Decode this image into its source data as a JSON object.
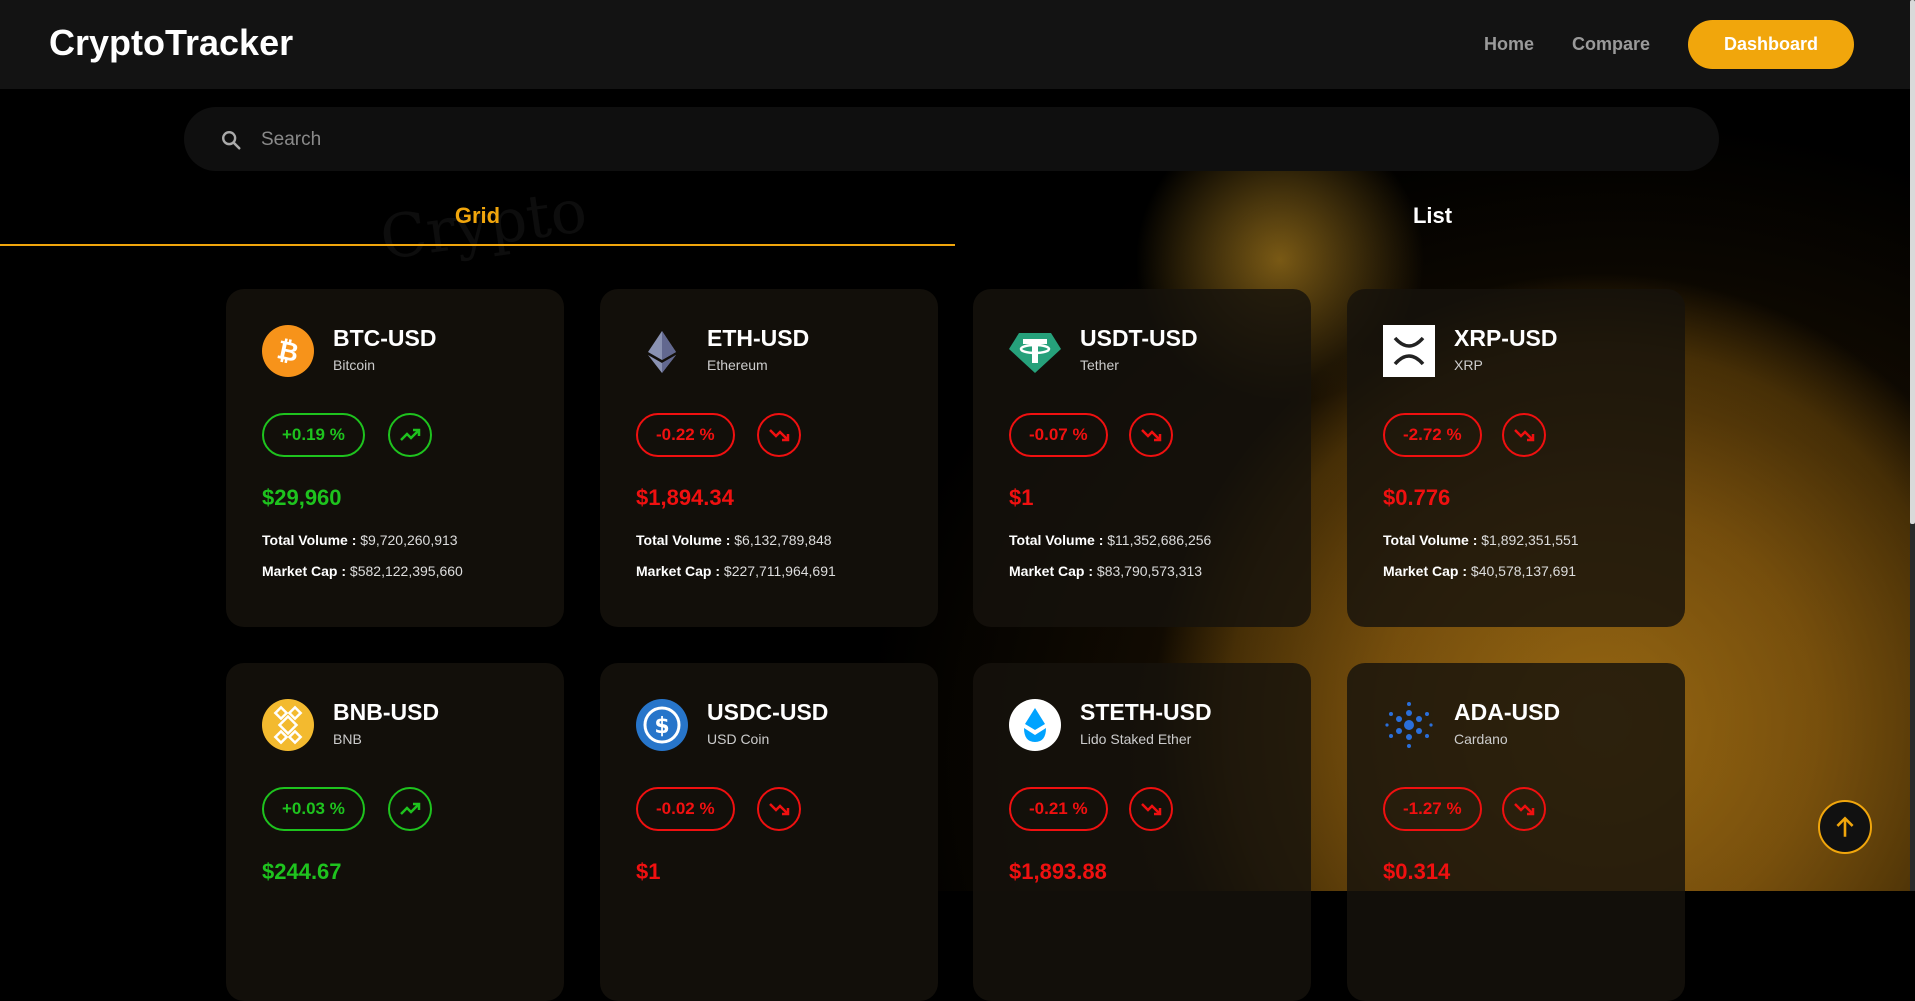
{
  "header": {
    "logo": "CryptoTracker",
    "nav": {
      "home": "Home",
      "compare": "Compare",
      "dashboard": "Dashboard"
    }
  },
  "search": {
    "placeholder": "Search",
    "value": ""
  },
  "tabs": {
    "grid": "Grid",
    "list": "List",
    "active": "Grid"
  },
  "colors": {
    "accent": "#f1a60c",
    "up": "#1ec31e",
    "down": "#f01010"
  },
  "cards": [
    {
      "symbol": "BTC-USD",
      "name": "Bitcoin",
      "change": "+0.19 %",
      "trend": "up",
      "price": "$29,960",
      "volume_label": "Total Volume :",
      "volume": "$9,720,260,913",
      "cap_label": "Market Cap :",
      "cap": "$582,122,395,660",
      "icon": "bitcoin-icon"
    },
    {
      "symbol": "ETH-USD",
      "name": "Ethereum",
      "change": "-0.22 %",
      "trend": "down",
      "price": "$1,894.34",
      "volume_label": "Total Volume :",
      "volume": "$6,132,789,848",
      "cap_label": "Market Cap :",
      "cap": "$227,711,964,691",
      "icon": "ethereum-icon"
    },
    {
      "symbol": "USDT-USD",
      "name": "Tether",
      "change": "-0.07 %",
      "trend": "down",
      "price": "$1",
      "volume_label": "Total Volume :",
      "volume": "$11,352,686,256",
      "cap_label": "Market Cap :",
      "cap": "$83,790,573,313",
      "icon": "tether-icon"
    },
    {
      "symbol": "XRP-USD",
      "name": "XRP",
      "change": "-2.72 %",
      "trend": "down",
      "price": "$0.776",
      "volume_label": "Total Volume :",
      "volume": "$1,892,351,551",
      "cap_label": "Market Cap :",
      "cap": "$40,578,137,691",
      "icon": "xrp-icon"
    },
    {
      "symbol": "BNB-USD",
      "name": "BNB",
      "change": "+0.03 %",
      "trend": "up",
      "price": "$244.67",
      "icon": "bnb-icon"
    },
    {
      "symbol": "USDC-USD",
      "name": "USD Coin",
      "change": "-0.02 %",
      "trend": "down",
      "price": "$1",
      "icon": "usdc-icon"
    },
    {
      "symbol": "STETH-USD",
      "name": "Lido Staked Ether",
      "change": "-0.21 %",
      "trend": "down",
      "price": "$1,893.88",
      "icon": "steth-icon"
    },
    {
      "symbol": "ADA-USD",
      "name": "Cardano",
      "change": "-1.27 %",
      "trend": "down",
      "price": "$0.314",
      "icon": "cardano-icon"
    }
  ]
}
